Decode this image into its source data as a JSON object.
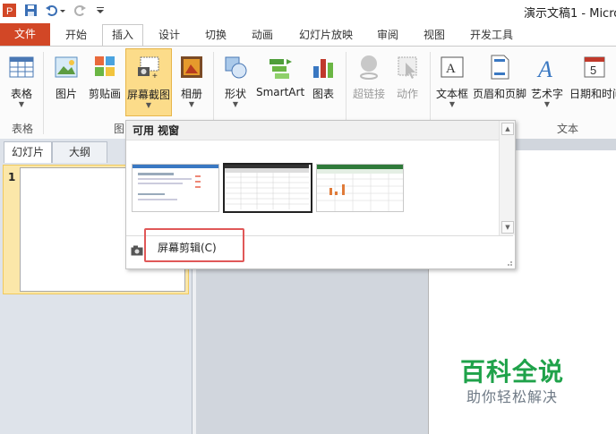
{
  "window": {
    "title": "演示文稿1 - Micro"
  },
  "quick_access": {
    "icons": [
      "powerpoint-app-icon",
      "save-icon",
      "undo-icon",
      "redo-icon",
      "customize-icon"
    ]
  },
  "tabs": [
    {
      "label": "文件"
    },
    {
      "label": "开始"
    },
    {
      "label": "插入"
    },
    {
      "label": "设计"
    },
    {
      "label": "切换"
    },
    {
      "label": "动画"
    },
    {
      "label": "幻灯片放映"
    },
    {
      "label": "审阅"
    },
    {
      "label": "视图"
    },
    {
      "label": "开发工具"
    }
  ],
  "ribbon": {
    "buttons": {
      "table": "表格",
      "picture": "图片",
      "clipart": "剪贴画",
      "screenshot": "屏幕截图",
      "album": "相册",
      "shapes": "形状",
      "smartart": "SmartArt",
      "chart": "图表",
      "hyperlink": "超链接",
      "action": "动作",
      "textbox": "文本框",
      "header_footer": "页眉和页脚",
      "wordart": "艺术字",
      "datetime": "日期和时间"
    },
    "groups": {
      "tables": "表格",
      "images_partial": "图",
      "text": "文本"
    }
  },
  "dropdown": {
    "header": "可用 视窗",
    "clip_label": "屏幕剪辑(C)"
  },
  "left_pane": {
    "tabs": [
      "幻灯片",
      "大纲"
    ],
    "slide_number": "1"
  },
  "watermark": {
    "title": "百科全说",
    "subtitle": "助你轻松解决"
  },
  "colors": {
    "file_tab": "#d24726",
    "selection_highlight": "#fbe7a9",
    "callout_border": "#e05858",
    "watermark_green": "#1fa24a"
  }
}
